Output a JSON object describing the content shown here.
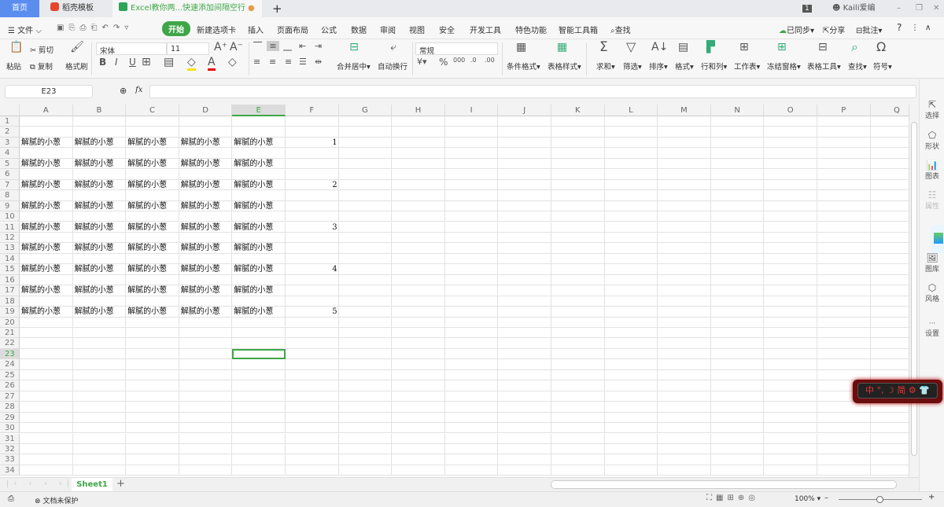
{
  "tabs": [
    {
      "label": "首页"
    },
    {
      "label": "稻壳模板"
    },
    {
      "label": "Excel教你两...快速添加间隔空行"
    }
  ],
  "window": {
    "badge": "1",
    "user": "Kaili爱编"
  },
  "menu": {
    "file": "文件",
    "items": [
      "开始",
      "新建选项卡",
      "插入",
      "页面布局",
      "公式",
      "数据",
      "审阅",
      "视图",
      "安全",
      "开发工具",
      "特色功能",
      "智能工具箱"
    ],
    "search": "查找",
    "sync": "已同步",
    "share": "分享",
    "comment": "批注"
  },
  "ribbon": {
    "paste": "粘贴",
    "cut": "剪切",
    "copy": "复制",
    "format_painter": "格式刷",
    "font": "宋体",
    "size": "11",
    "merge": "合并居中",
    "wrap": "自动换行",
    "number_format": "常规",
    "cond_format": "条件格式",
    "table_style": "表格样式",
    "sum": "求和",
    "filter": "筛选",
    "sort": "排序",
    "format": "格式",
    "rowcol": "行和列",
    "sheet": "工作表",
    "freeze": "冻结窗格",
    "table_tools": "表格工具",
    "find": "查找",
    "symbol": "符号"
  },
  "formula": {
    "name_box": "E23",
    "fx": "fx",
    "value": ""
  },
  "grid": {
    "columns": [
      "A",
      "B",
      "C",
      "D",
      "E",
      "F",
      "G",
      "H",
      "I",
      "J",
      "K",
      "L",
      "M",
      "N",
      "O",
      "P",
      "Q"
    ],
    "row_count": 34,
    "selected": "E23",
    "cells": [
      {
        "row": 3,
        "values": [
          "解腻的小葱",
          "解腻的小葱",
          "解腻的小葱",
          "解腻的小葱",
          "解腻的小葱",
          "1"
        ]
      },
      {
        "row": 5,
        "values": [
          "解腻的小葱",
          "解腻的小葱",
          "解腻的小葱",
          "解腻的小葱",
          "解腻的小葱",
          ""
        ]
      },
      {
        "row": 7,
        "values": [
          "解腻的小葱",
          "解腻的小葱",
          "解腻的小葱",
          "解腻的小葱",
          "解腻的小葱",
          "2"
        ]
      },
      {
        "row": 9,
        "values": [
          "解腻的小葱",
          "解腻的小葱",
          "解腻的小葱",
          "解腻的小葱",
          "解腻的小葱",
          ""
        ]
      },
      {
        "row": 11,
        "values": [
          "解腻的小葱",
          "解腻的小葱",
          "解腻的小葱",
          "解腻的小葱",
          "解腻的小葱",
          "3"
        ]
      },
      {
        "row": 13,
        "values": [
          "解腻的小葱",
          "解腻的小葱",
          "解腻的小葱",
          "解腻的小葱",
          "解腻的小葱",
          ""
        ]
      },
      {
        "row": 15,
        "values": [
          "解腻的小葱",
          "解腻的小葱",
          "解腻的小葱",
          "解腻的小葱",
          "解腻的小葱",
          "4"
        ]
      },
      {
        "row": 17,
        "values": [
          "解腻的小葱",
          "解腻的小葱",
          "解腻的小葱",
          "解腻的小葱",
          "解腻的小葱",
          ""
        ]
      },
      {
        "row": 19,
        "values": [
          "解腻的小葱",
          "解腻的小葱",
          "解腻的小葱",
          "解腻的小葱",
          "解腻的小葱",
          "5"
        ]
      }
    ]
  },
  "sidebar": [
    "选择",
    "形状",
    "图表",
    "属性",
    "图库",
    "风格",
    "设置"
  ],
  "sheets": [
    "Sheet1"
  ],
  "status": {
    "protect": "文档未保护",
    "zoom": "100%"
  },
  "ime": "中 °, ☽ 简 ⚙ 👕",
  "colors": {
    "accent": "#3fa648",
    "tab_home": "#5b8def"
  }
}
